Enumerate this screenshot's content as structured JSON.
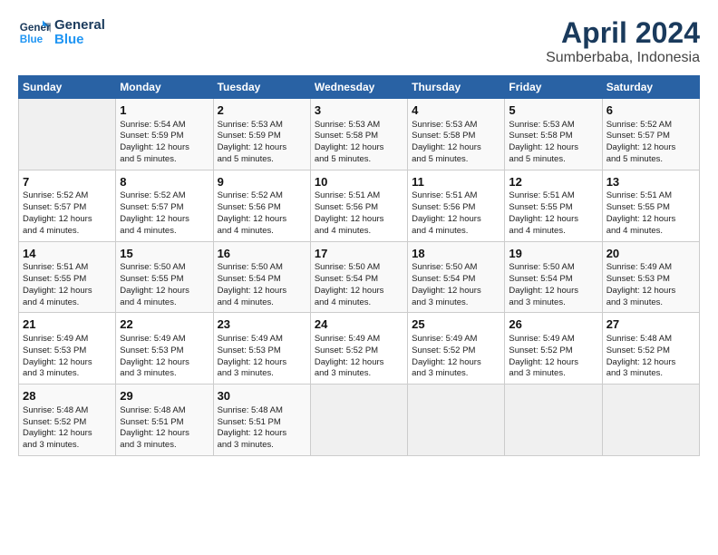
{
  "header": {
    "logo_line1": "General",
    "logo_line2": "Blue",
    "title": "April 2024",
    "subtitle": "Sumberbaba, Indonesia"
  },
  "columns": [
    "Sunday",
    "Monday",
    "Tuesday",
    "Wednesday",
    "Thursday",
    "Friday",
    "Saturday"
  ],
  "weeks": [
    {
      "cells": [
        {
          "empty": true
        },
        {
          "day": 1,
          "lines": [
            "Sunrise: 5:54 AM",
            "Sunset: 5:59 PM",
            "Daylight: 12 hours",
            "and 5 minutes."
          ]
        },
        {
          "day": 2,
          "lines": [
            "Sunrise: 5:53 AM",
            "Sunset: 5:59 PM",
            "Daylight: 12 hours",
            "and 5 minutes."
          ]
        },
        {
          "day": 3,
          "lines": [
            "Sunrise: 5:53 AM",
            "Sunset: 5:58 PM",
            "Daylight: 12 hours",
            "and 5 minutes."
          ]
        },
        {
          "day": 4,
          "lines": [
            "Sunrise: 5:53 AM",
            "Sunset: 5:58 PM",
            "Daylight: 12 hours",
            "and 5 minutes."
          ]
        },
        {
          "day": 5,
          "lines": [
            "Sunrise: 5:53 AM",
            "Sunset: 5:58 PM",
            "Daylight: 12 hours",
            "and 5 minutes."
          ]
        },
        {
          "day": 6,
          "lines": [
            "Sunrise: 5:52 AM",
            "Sunset: 5:57 PM",
            "Daylight: 12 hours",
            "and 5 minutes."
          ]
        }
      ]
    },
    {
      "cells": [
        {
          "day": 7,
          "lines": [
            "Sunrise: 5:52 AM",
            "Sunset: 5:57 PM",
            "Daylight: 12 hours",
            "and 4 minutes."
          ]
        },
        {
          "day": 8,
          "lines": [
            "Sunrise: 5:52 AM",
            "Sunset: 5:57 PM",
            "Daylight: 12 hours",
            "and 4 minutes."
          ]
        },
        {
          "day": 9,
          "lines": [
            "Sunrise: 5:52 AM",
            "Sunset: 5:56 PM",
            "Daylight: 12 hours",
            "and 4 minutes."
          ]
        },
        {
          "day": 10,
          "lines": [
            "Sunrise: 5:51 AM",
            "Sunset: 5:56 PM",
            "Daylight: 12 hours",
            "and 4 minutes."
          ]
        },
        {
          "day": 11,
          "lines": [
            "Sunrise: 5:51 AM",
            "Sunset: 5:56 PM",
            "Daylight: 12 hours",
            "and 4 minutes."
          ]
        },
        {
          "day": 12,
          "lines": [
            "Sunrise: 5:51 AM",
            "Sunset: 5:55 PM",
            "Daylight: 12 hours",
            "and 4 minutes."
          ]
        },
        {
          "day": 13,
          "lines": [
            "Sunrise: 5:51 AM",
            "Sunset: 5:55 PM",
            "Daylight: 12 hours",
            "and 4 minutes."
          ]
        }
      ]
    },
    {
      "cells": [
        {
          "day": 14,
          "lines": [
            "Sunrise: 5:51 AM",
            "Sunset: 5:55 PM",
            "Daylight: 12 hours",
            "and 4 minutes."
          ]
        },
        {
          "day": 15,
          "lines": [
            "Sunrise: 5:50 AM",
            "Sunset: 5:55 PM",
            "Daylight: 12 hours",
            "and 4 minutes."
          ]
        },
        {
          "day": 16,
          "lines": [
            "Sunrise: 5:50 AM",
            "Sunset: 5:54 PM",
            "Daylight: 12 hours",
            "and 4 minutes."
          ]
        },
        {
          "day": 17,
          "lines": [
            "Sunrise: 5:50 AM",
            "Sunset: 5:54 PM",
            "Daylight: 12 hours",
            "and 4 minutes."
          ]
        },
        {
          "day": 18,
          "lines": [
            "Sunrise: 5:50 AM",
            "Sunset: 5:54 PM",
            "Daylight: 12 hours",
            "and 3 minutes."
          ]
        },
        {
          "day": 19,
          "lines": [
            "Sunrise: 5:50 AM",
            "Sunset: 5:54 PM",
            "Daylight: 12 hours",
            "and 3 minutes."
          ]
        },
        {
          "day": 20,
          "lines": [
            "Sunrise: 5:49 AM",
            "Sunset: 5:53 PM",
            "Daylight: 12 hours",
            "and 3 minutes."
          ]
        }
      ]
    },
    {
      "cells": [
        {
          "day": 21,
          "lines": [
            "Sunrise: 5:49 AM",
            "Sunset: 5:53 PM",
            "Daylight: 12 hours",
            "and 3 minutes."
          ]
        },
        {
          "day": 22,
          "lines": [
            "Sunrise: 5:49 AM",
            "Sunset: 5:53 PM",
            "Daylight: 12 hours",
            "and 3 minutes."
          ]
        },
        {
          "day": 23,
          "lines": [
            "Sunrise: 5:49 AM",
            "Sunset: 5:53 PM",
            "Daylight: 12 hours",
            "and 3 minutes."
          ]
        },
        {
          "day": 24,
          "lines": [
            "Sunrise: 5:49 AM",
            "Sunset: 5:52 PM",
            "Daylight: 12 hours",
            "and 3 minutes."
          ]
        },
        {
          "day": 25,
          "lines": [
            "Sunrise: 5:49 AM",
            "Sunset: 5:52 PM",
            "Daylight: 12 hours",
            "and 3 minutes."
          ]
        },
        {
          "day": 26,
          "lines": [
            "Sunrise: 5:49 AM",
            "Sunset: 5:52 PM",
            "Daylight: 12 hours",
            "and 3 minutes."
          ]
        },
        {
          "day": 27,
          "lines": [
            "Sunrise: 5:48 AM",
            "Sunset: 5:52 PM",
            "Daylight: 12 hours",
            "and 3 minutes."
          ]
        }
      ]
    },
    {
      "cells": [
        {
          "day": 28,
          "lines": [
            "Sunrise: 5:48 AM",
            "Sunset: 5:52 PM",
            "Daylight: 12 hours",
            "and 3 minutes."
          ]
        },
        {
          "day": 29,
          "lines": [
            "Sunrise: 5:48 AM",
            "Sunset: 5:51 PM",
            "Daylight: 12 hours",
            "and 3 minutes."
          ]
        },
        {
          "day": 30,
          "lines": [
            "Sunrise: 5:48 AM",
            "Sunset: 5:51 PM",
            "Daylight: 12 hours",
            "and 3 minutes."
          ]
        },
        {
          "empty": true
        },
        {
          "empty": true
        },
        {
          "empty": true
        },
        {
          "empty": true
        }
      ]
    }
  ]
}
